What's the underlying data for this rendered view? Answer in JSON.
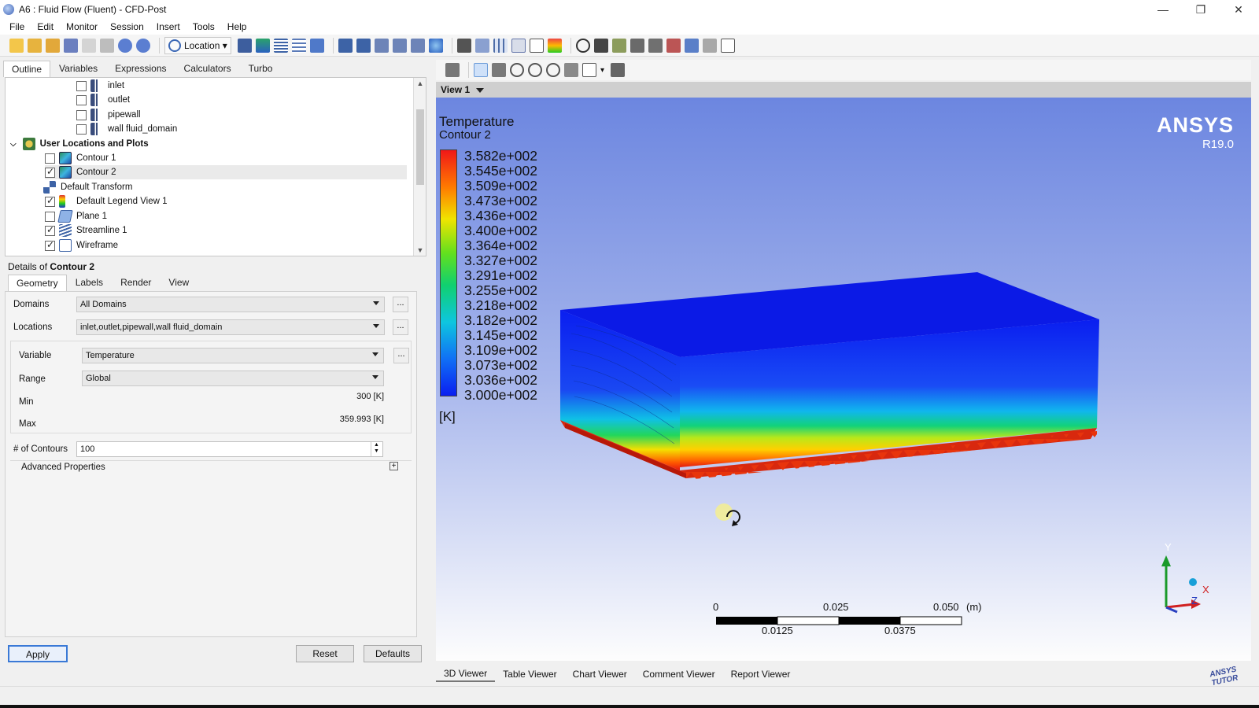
{
  "window": {
    "title": "A6 : Fluid Flow (Fluent) - CFD-Post",
    "minimize": "—",
    "restore": "❐",
    "close": "✕"
  },
  "menu": [
    "File",
    "Edit",
    "Monitor",
    "Session",
    "Insert",
    "Tools",
    "Help"
  ],
  "toolbar": {
    "location_label": "Location"
  },
  "outline": {
    "tabs": [
      "Outline",
      "Variables",
      "Expressions",
      "Calculators",
      "Turbo"
    ],
    "items": [
      {
        "label": "inlet",
        "checked": false,
        "icon": "boundary-icon"
      },
      {
        "label": "outlet",
        "checked": false,
        "icon": "boundary-icon"
      },
      {
        "label": "pipewall",
        "checked": false,
        "icon": "boundary-icon"
      },
      {
        "label": "wall fluid_domain",
        "checked": false,
        "icon": "boundary-icon"
      },
      {
        "label": "User Locations and Plots",
        "icon": "user-locations-icon"
      },
      {
        "label": "Contour 1",
        "checked": false,
        "icon": "contour-icon"
      },
      {
        "label": "Contour 2",
        "checked": true,
        "icon": "contour-icon"
      },
      {
        "label": "Default Transform",
        "icon": "transform-icon"
      },
      {
        "label": "Default Legend View 1",
        "checked": true,
        "icon": "legend-icon"
      },
      {
        "label": "Plane 1",
        "checked": false,
        "icon": "plane-icon"
      },
      {
        "label": "Streamline 1",
        "checked": true,
        "icon": "streamline-icon"
      },
      {
        "label": "Wireframe",
        "checked": true,
        "icon": "wireframe-icon"
      }
    ]
  },
  "details": {
    "title_prefix": "Details of ",
    "object": "Contour 2",
    "tabs": [
      "Geometry",
      "Labels",
      "Render",
      "View"
    ],
    "domains_label": "Domains",
    "domains": "All Domains",
    "locations_label": "Locations",
    "locations": "inlet,outlet,pipewall,wall fluid_domain",
    "variable_label": "Variable",
    "variable": "Temperature",
    "range_label": "Range",
    "range": "Global",
    "min_label": "Min",
    "min": "300 [K]",
    "max_label": "Max",
    "max": "359.993 [K]",
    "contours_label": "# of Contours",
    "contours": "100",
    "advanced": "Advanced Properties",
    "ellipsis": "..."
  },
  "buttons": {
    "apply": "Apply",
    "reset": "Reset",
    "defaults": "Defaults"
  },
  "viewer": {
    "view_name": "View 1",
    "legend": {
      "title": "Temperature",
      "subtitle": "Contour 2",
      "labels": [
        "3.582e+002",
        "3.545e+002",
        "3.509e+002",
        "3.473e+002",
        "3.436e+002",
        "3.400e+002",
        "3.364e+002",
        "3.327e+002",
        "3.291e+002",
        "3.255e+002",
        "3.218e+002",
        "3.182e+002",
        "3.145e+002",
        "3.109e+002",
        "3.073e+002",
        "3.036e+002",
        "3.000e+002"
      ],
      "unit": "[K]"
    },
    "brand": {
      "name": "ANSYS",
      "version": "R19.0"
    },
    "scale": {
      "top": [
        "0",
        "0.025",
        "0.050"
      ],
      "unit": "(m)",
      "bottom": [
        "0.0125",
        "0.0375"
      ]
    },
    "axes": {
      "y": "Y",
      "x": "X",
      "z": "Z"
    },
    "bottom_tabs": [
      "3D Viewer",
      "Table Viewer",
      "Chart Viewer",
      "Comment Viewer",
      "Report Viewer"
    ]
  },
  "corner_logo": "ANSYS TUTOR",
  "colors": {
    "accent": "#3a79d6",
    "viewport_top": "#6c86e0",
    "viewport_bottom": "#fdfdfd"
  }
}
